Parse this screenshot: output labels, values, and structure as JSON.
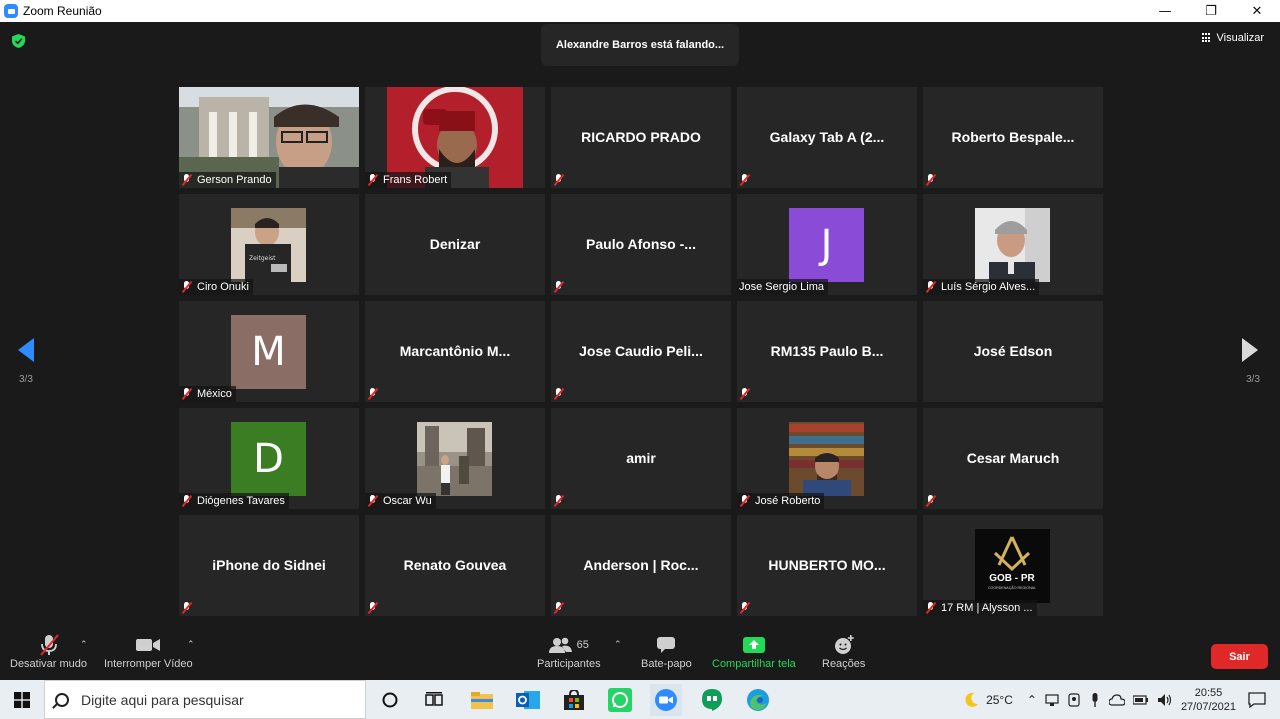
{
  "window": {
    "title": "Zoom Reunião",
    "controls": [
      "—",
      "❐",
      "✕"
    ]
  },
  "meeting": {
    "speaking_banner": "Alexandre Barros está falando...",
    "view_label": "Visualizar",
    "page_indicator": "3/3"
  },
  "participants": [
    {
      "name": "Gerson Prando",
      "kind": "video"
    },
    {
      "name": "Frans Robert",
      "kind": "video"
    },
    {
      "name": "RICARDO PRADO",
      "kind": "text"
    },
    {
      "name": "Galaxy Tab A (2...",
      "kind": "text"
    },
    {
      "name": "Roberto  Bespale...",
      "kind": "text"
    },
    {
      "name": "Ciro Onuki",
      "kind": "photo"
    },
    {
      "name": "Denizar",
      "kind": "text",
      "unmuted": true
    },
    {
      "name": "Paulo Afonso -...",
      "kind": "text"
    },
    {
      "name": "Jose Sergio Lima",
      "kind": "letter",
      "letter": "J",
      "color": "#8a4bd6",
      "unmuted": true
    },
    {
      "name": "Luís Sérgio Alves...",
      "kind": "photo"
    },
    {
      "name": "México",
      "kind": "letter",
      "letter": "M",
      "color": "#8a6e66"
    },
    {
      "name": "Marcantônio  M...",
      "kind": "text"
    },
    {
      "name": "Jose Caudio Peli...",
      "kind": "text"
    },
    {
      "name": "RM135  Paulo B...",
      "kind": "text"
    },
    {
      "name": "José Edson",
      "kind": "text",
      "unmuted": true
    },
    {
      "name": "Diógenes Tavares",
      "kind": "letter",
      "letter": "D",
      "color": "#3b7d22"
    },
    {
      "name": "Oscar Wu",
      "kind": "photo"
    },
    {
      "name": "amir",
      "kind": "text"
    },
    {
      "name": "José Roberto",
      "kind": "photo"
    },
    {
      "name": "Cesar Maruch",
      "kind": "text"
    },
    {
      "name": "iPhone do Sidnei",
      "kind": "text"
    },
    {
      "name": "Renato Gouvea",
      "kind": "text"
    },
    {
      "name": "Anderson | Roc...",
      "kind": "text"
    },
    {
      "name": "HUNBERTO  MO...",
      "kind": "text"
    },
    {
      "name": "17 RM | Alysson ...",
      "kind": "logo",
      "logo_text": "GOB - PR",
      "logo_sub": "COORDENAÇÃO REGIONAL"
    }
  ],
  "toolbar": {
    "mute_label": "Desativar mudo",
    "video_label": "Interromper Vídeo",
    "participants_label": "Participantes",
    "participants_count": "65",
    "chat_label": "Bate-papo",
    "share_label": "Compartilhar tela",
    "reactions_label": "Reações",
    "leave_label": "Sair"
  },
  "taskbar": {
    "search_placeholder": "Digite aqui para pesquisar",
    "weather": "25°C",
    "time": "20:55",
    "date": "27/07/2021"
  },
  "colors": {
    "accent": "#2d8cff",
    "share": "#23d959",
    "leave": "#e02828",
    "mute_red": "#e02828"
  }
}
